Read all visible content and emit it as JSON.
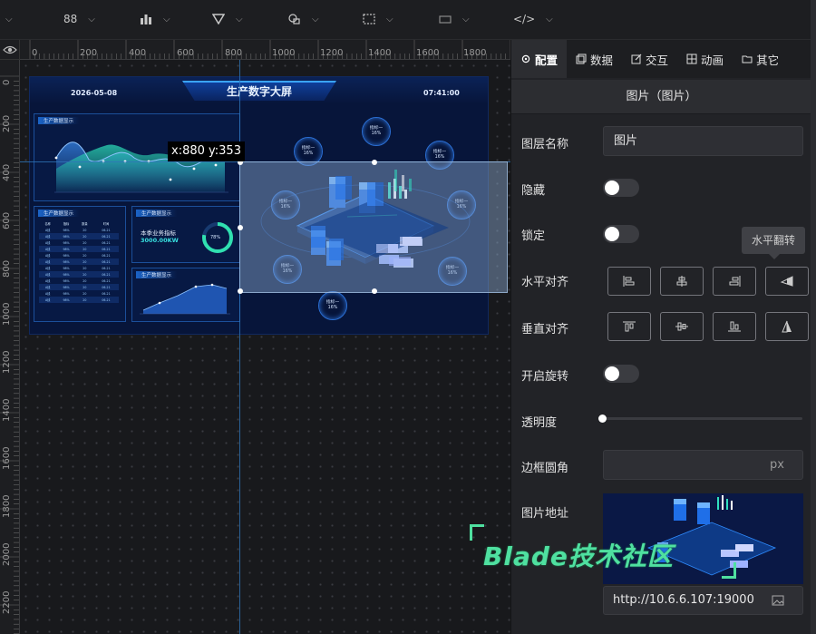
{
  "toolbar": {
    "items": [
      {
        "icon": "grid-icon",
        "label": "88"
      },
      {
        "icon": "bar-chart-icon",
        "label": ""
      },
      {
        "icon": "filter-icon",
        "label": ""
      },
      {
        "icon": "shapes-icon",
        "label": ""
      },
      {
        "icon": "selection-icon",
        "label": ""
      },
      {
        "icon": "media-icon",
        "label": ""
      },
      {
        "icon": "code-icon",
        "label": "</>"
      }
    ]
  },
  "ruler": {
    "top_ticks": [
      "0",
      "200",
      "400",
      "600",
      "800",
      "1000",
      "1200",
      "1400",
      "1600",
      "1800"
    ],
    "left_ticks": [
      "0",
      "200",
      "400",
      "600",
      "800",
      "1000",
      "1200",
      "1400",
      "1600",
      "1800",
      "2000",
      "2200"
    ]
  },
  "canvas": {
    "coord_tip": "x:880 y:353"
  },
  "dashboard": {
    "title": "生产数字大屏",
    "date": "2026-05-08",
    "time": "07:41:00",
    "panel_line_title": "生产数据显示",
    "panel_table_title": "生产数据显示",
    "panel_kpi_title": "生产数据显示",
    "panel_area_title": "生产数据显示",
    "kpi_label": "本季业务指标",
    "kpi_value": "3000.00KW",
    "ring_percent": "78%",
    "table_headers": [
      "名称",
      "指标",
      "数量",
      "时间"
    ],
    "table_rows": [
      [
        "A线",
        "98%",
        "20",
        "06-21"
      ],
      [
        "A线",
        "98%",
        "20",
        "06-21"
      ],
      [
        "A线",
        "98%",
        "20",
        "06-21"
      ],
      [
        "A线",
        "98%",
        "20",
        "06-21"
      ],
      [
        "A线",
        "98%",
        "20",
        "06-21"
      ],
      [
        "A线",
        "98%",
        "20",
        "06-21"
      ],
      [
        "A线",
        "98%",
        "20",
        "06-21"
      ],
      [
        "A线",
        "98%",
        "20",
        "06-21"
      ],
      [
        "A线",
        "98%",
        "20",
        "06-21"
      ],
      [
        "A线",
        "98%",
        "20",
        "06-21"
      ],
      [
        "A线",
        "98%",
        "20",
        "06-21"
      ],
      [
        "A线",
        "98%",
        "20",
        "06-21"
      ]
    ],
    "bubbles": [
      {
        "label": "指标一",
        "value": "16%"
      },
      {
        "label": "指标一",
        "value": "16%"
      },
      {
        "label": "指标一",
        "value": "16%"
      },
      {
        "label": "指标一",
        "value": "16%"
      },
      {
        "label": "指标一",
        "value": "16%"
      },
      {
        "label": "指标一",
        "value": "16%"
      },
      {
        "label": "指标一",
        "value": "16%"
      },
      {
        "label": "指标一",
        "value": "16%"
      }
    ]
  },
  "panel": {
    "tabs": [
      {
        "icon": "gear-icon",
        "label": "配置"
      },
      {
        "icon": "copy-icon",
        "label": "数据"
      },
      {
        "icon": "edit-icon",
        "label": "交互"
      },
      {
        "icon": "film-icon",
        "label": "动画"
      },
      {
        "icon": "folder-icon",
        "label": "其它"
      }
    ],
    "active_tab": "配置",
    "subheader": "图片（图片）",
    "layer_name_label": "图层名称",
    "layer_name_value": "图片",
    "hidden_label": "隐藏",
    "locked_label": "锁定",
    "h_align_label": "水平对齐",
    "v_align_label": "垂直对齐",
    "rotate_label": "开启旋转",
    "opacity_label": "透明度",
    "radius_label": "边框圆角",
    "radius_unit": "px",
    "image_url_label": "图片地址",
    "image_url_value": "http://10.6.6.107:19000",
    "tooltip": "水平翻转"
  },
  "watermark": {
    "text": "Blade技术社区",
    "color": "#4fe0a0"
  },
  "colors": {
    "accent": "#2f74b8",
    "toolbar_bg": "#1d1e21",
    "panel_bg": "#222327",
    "dashboard_bg": "#07153a"
  }
}
